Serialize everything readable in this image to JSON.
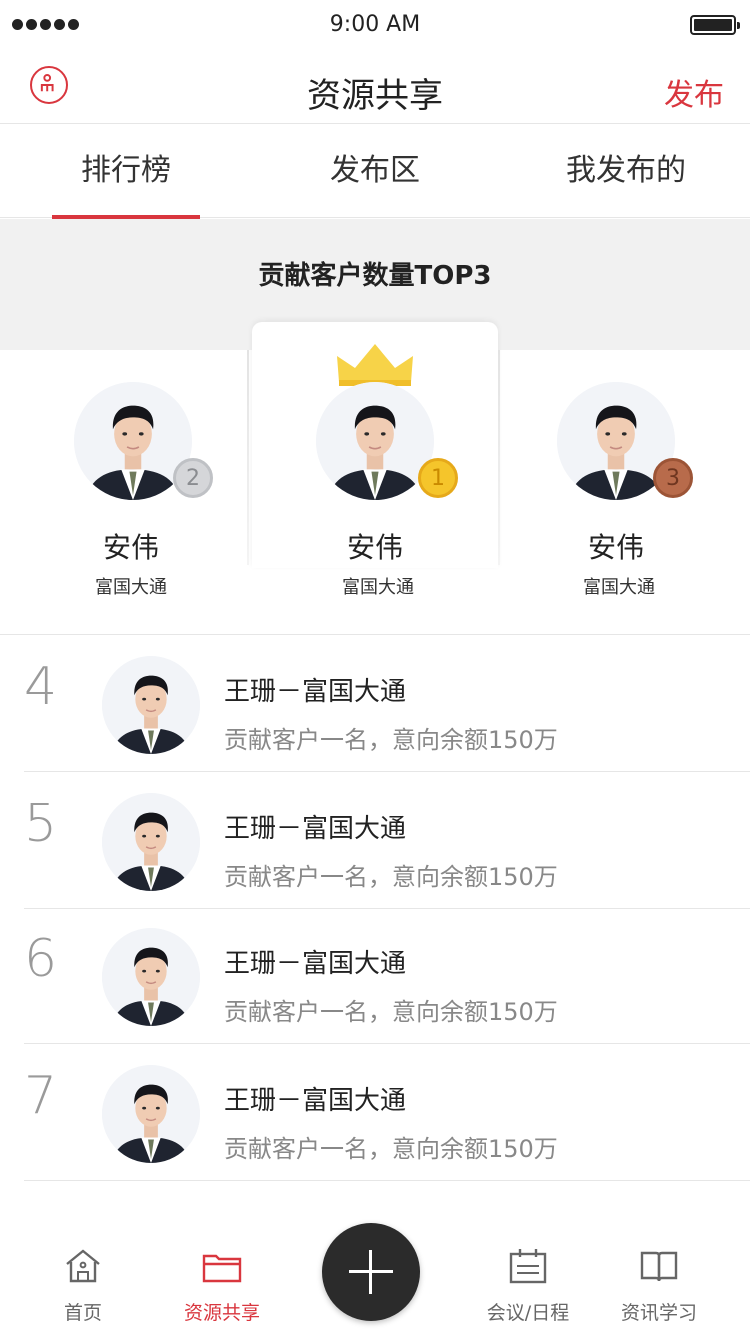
{
  "status_bar": {
    "time": "9:00 AM"
  },
  "header": {
    "title": "资源共享",
    "publish_label": "发布"
  },
  "tabs": [
    {
      "label": "排行榜",
      "active": true
    },
    {
      "label": "发布区",
      "active": false
    },
    {
      "label": "我发布的",
      "active": false
    }
  ],
  "top3": {
    "title": "贡献客户数量TOP3",
    "entries": [
      {
        "rank": "2",
        "name": "安伟",
        "org": "富国大通"
      },
      {
        "rank": "1",
        "name": "安伟",
        "org": "富国大通"
      },
      {
        "rank": "3",
        "name": "安伟",
        "org": "富国大通"
      }
    ]
  },
  "ranking": [
    {
      "rank": "4",
      "title": "王珊－富国大通",
      "subtitle": "贡献客户一名，意向余额150万"
    },
    {
      "rank": "5",
      "title": "王珊－富国大通",
      "subtitle": "贡献客户一名，意向余额150万"
    },
    {
      "rank": "6",
      "title": "王珊－富国大通",
      "subtitle": "贡献客户一名，意向余额150万"
    },
    {
      "rank": "7",
      "title": "王珊－富国大通",
      "subtitle": "贡献客户一名，意向余额150万"
    }
  ],
  "tabbar": {
    "items": [
      {
        "label": "首页",
        "icon": "home-icon"
      },
      {
        "label": "资源共享",
        "icon": "folder-icon"
      },
      {
        "label": "会议/日程",
        "icon": "calendar-icon"
      },
      {
        "label": "资讯学习",
        "icon": "book-icon"
      }
    ],
    "fab_icon": "plus-icon"
  },
  "colors": {
    "accent": "#d9363e",
    "gold": "#f5c52b",
    "silver": "#d5d6d9",
    "bronze": "#b86b4b"
  }
}
